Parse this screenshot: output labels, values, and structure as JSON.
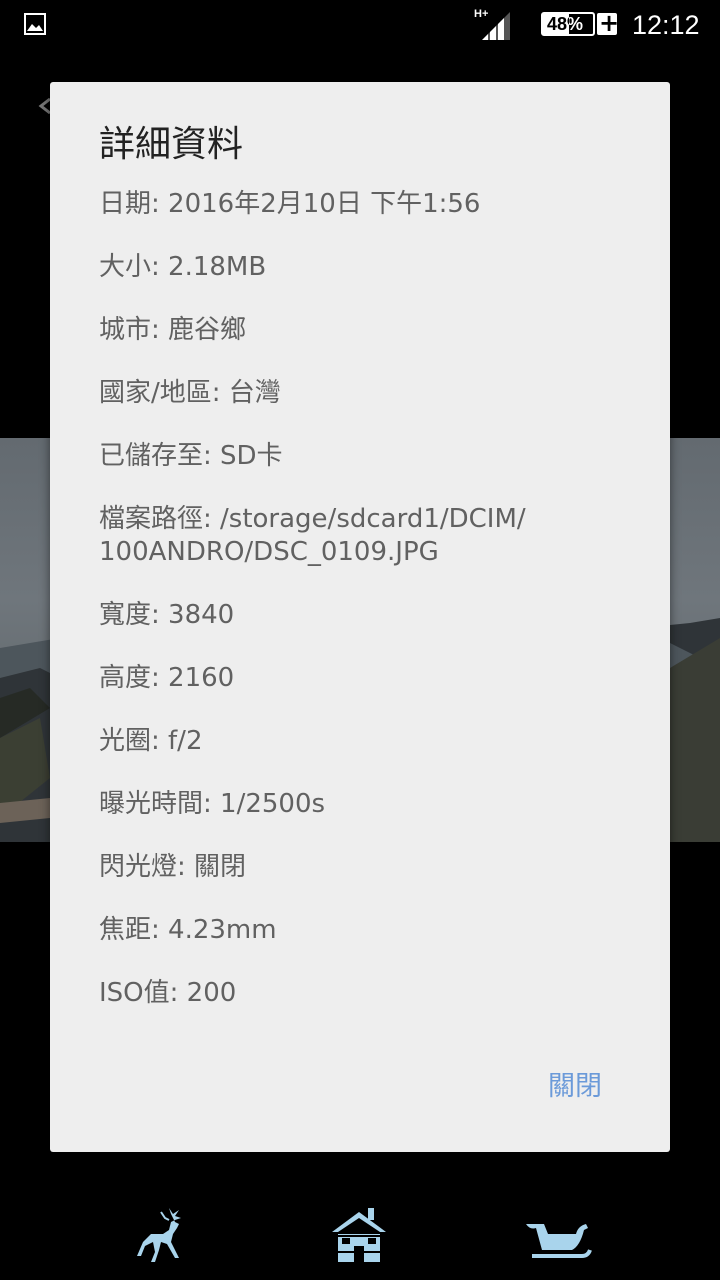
{
  "status_bar": {
    "network_type": "H+",
    "battery_percent": "48%",
    "charging_symbol": "+",
    "time": "12:12",
    "icons": [
      "gallery-icon",
      "signal-icon",
      "battery-icon"
    ]
  },
  "dialog": {
    "title": "詳細資料",
    "details": [
      "日期: 2016年2月10日 下午1:56",
      "大小: 2.18MB",
      "城市: 鹿谷鄉",
      "國家/地區: 台灣",
      "已儲存至: SD卡",
      "檔案路徑: /storage/sdcard1/DCIM/\n100ANDRO/DSC_0109.JPG",
      "寬度: 3840",
      "高度: 2160",
      "光圈: f/2",
      "曝光時間: 1/2500s",
      "閃光燈: 關閉",
      "焦距: 4.23mm",
      "ISO值: 200"
    ],
    "close_label": "關閉"
  },
  "bottom_nav": {
    "icons": [
      "reindeer-icon",
      "house-icon",
      "sleigh-icon"
    ],
    "accent_color": "#a9d4ec"
  },
  "colors": {
    "dialog_bg": "#eeeeee",
    "title_text": "#222222",
    "detail_text": "#616161",
    "button_text": "#6b9ad9"
  }
}
